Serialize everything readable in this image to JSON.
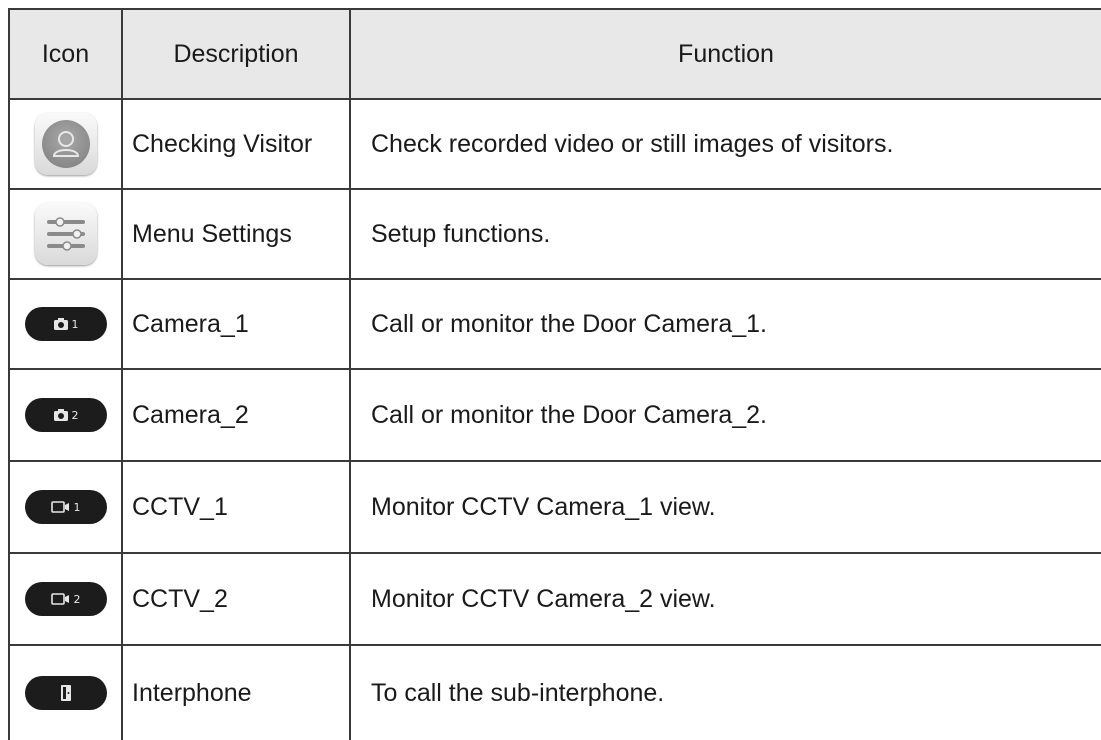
{
  "header": {
    "icon": "Icon",
    "description": "Description",
    "function": "Function"
  },
  "rows": [
    {
      "icon": "checking-visitor-icon",
      "description": "Checking Visitor",
      "function": "Check recorded video or still images of visitors."
    },
    {
      "icon": "menu-settings-icon",
      "description": "Menu Settings",
      "function": "Setup functions."
    },
    {
      "icon": "camera-1-icon",
      "icon_label": "1",
      "description": "Camera_1",
      "function": "Call or monitor the Door Camera_1."
    },
    {
      "icon": "camera-2-icon",
      "icon_label": "2",
      "description": "Camera_2",
      "function": "Call or monitor the Door Camera_2."
    },
    {
      "icon": "cctv-1-icon",
      "icon_label": "1",
      "description": "CCTV_1",
      "function": "Monitor CCTV Camera_1 view."
    },
    {
      "icon": "cctv-2-icon",
      "icon_label": "2",
      "description": "CCTV_2",
      "function": "Monitor CCTV Camera_2 view."
    },
    {
      "icon": "interphone-icon",
      "description": "Interphone",
      "function": "To call the sub-interphone."
    }
  ],
  "colors": {
    "header_bg": "#e8e8e8",
    "border": "#3a3a3a",
    "pill_bg": "#1c1c1c"
  }
}
